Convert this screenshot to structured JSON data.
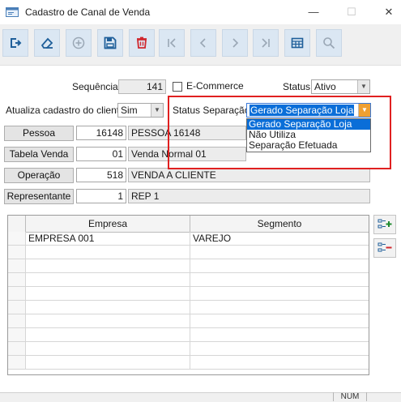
{
  "window": {
    "title": "Cadastro de Canal de Venda",
    "minimize_glyph": "—",
    "maximize_glyph": "☐",
    "close_glyph": "✕"
  },
  "toolbar": {
    "buttons": [
      {
        "name": "exit-icon"
      },
      {
        "name": "eraser-icon"
      },
      {
        "name": "add-icon"
      },
      {
        "name": "save-icon"
      },
      {
        "name": "delete-icon"
      },
      {
        "name": "first-record-icon"
      },
      {
        "name": "previous-record-icon"
      },
      {
        "name": "next-record-icon"
      },
      {
        "name": "last-record-icon"
      },
      {
        "name": "grid-view-icon"
      },
      {
        "name": "search-icon"
      }
    ]
  },
  "form": {
    "sequencia_label": "Sequência",
    "sequencia_value": "141",
    "ecommerce_label": "E-Commerce",
    "status_label": "Status",
    "status_value": "Ativo",
    "atualiza_label": "Atualiza cadastro do cliente",
    "atualiza_value": "Sim",
    "status_separacao_label": "Status Separação",
    "status_separacao_value": "Gerado Separação Loja",
    "status_separacao_options": [
      "Gerado Separação Loja",
      "Não Utiliza",
      "Separação Efetuada"
    ],
    "pessoa_button": "Pessoa",
    "pessoa_code": "16148",
    "pessoa_name": "PESSOA 16148",
    "tabela_button": "Tabela Venda",
    "tabela_code": "01",
    "tabela_name": "Venda Normal 01",
    "operacao_button": "Operação",
    "operacao_code": "518",
    "operacao_name": "VENDA A CLIENTE",
    "representante_button": "Representante",
    "representante_code": "1",
    "representante_name": "REP 1"
  },
  "grid": {
    "columns": [
      "Empresa",
      "Segmento"
    ],
    "rows": [
      [
        "EMPRESA 001",
        "VAREJO"
      ]
    ]
  },
  "statusbar": {
    "num": "NUM"
  },
  "colors": {
    "highlight": "#e02020",
    "selection": "#0a6ed8"
  }
}
